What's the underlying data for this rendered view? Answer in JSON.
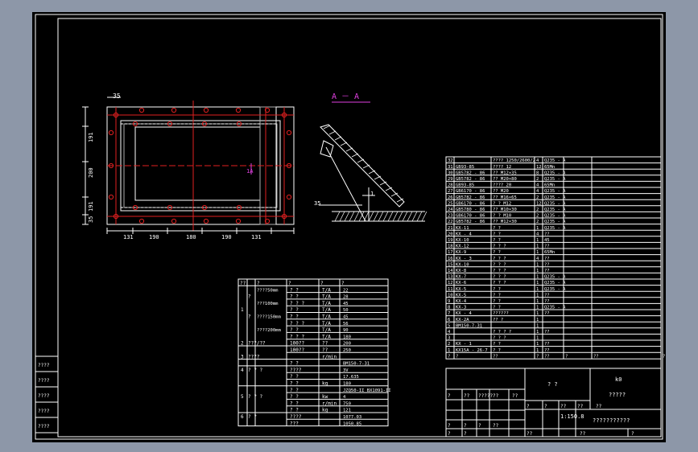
{
  "window_bg": "#8d97a8",
  "colors": {
    "line": "#ffffff",
    "red": "#e02020",
    "magenta": "#e040e0",
    "grey": "#b0b0b0"
  },
  "drawing": {
    "dims_top": "35",
    "dims_left": [
      "191",
      "200",
      "191",
      "35"
    ],
    "dims_bottom": [
      "131",
      "190",
      "180",
      "190",
      "131"
    ],
    "section_tag": "1A",
    "section_title": "A － A",
    "weld_label": "35",
    "weld_dim": "1"
  },
  "param_table": {
    "col_header": [
      "??",
      "",
      "?",
      "?",
      "?",
      "?"
    ],
    "rows": [
      {
        "no": "",
        "a": "",
        "b": "????50mm",
        "c": "? ?",
        "d": "T/A",
        "e": "22"
      },
      {
        "no": "",
        "a": "?",
        "b": "",
        "c": "? ?",
        "d": "T/A",
        "e": "28"
      },
      {
        "no": "",
        "a": "",
        "b": "???100mm",
        "c": "? ? ?",
        "d": "T/A",
        "e": "45"
      },
      {
        "no": "1",
        "a": "",
        "b": "",
        "c": "? ?",
        "d": "T/A",
        "e": "50"
      },
      {
        "no": "",
        "a": "?",
        "b": "????150mm",
        "c": "? ?",
        "d": "T/A",
        "e": "45"
      },
      {
        "no": "",
        "a": "",
        "b": "",
        "c": "? ? ?",
        "d": "T/A",
        "e": "56"
      },
      {
        "no": "",
        "a": "",
        "b": "????200mm",
        "c": "? ?",
        "d": "T/A",
        "e": "90"
      },
      {
        "no": "",
        "a": "",
        "b": "",
        "c": "? ? ?",
        "d": "T/A",
        "e": "180"
      },
      {
        "no": "2",
        "a": "???/??",
        "b": "",
        "c": "100??",
        "d": "??",
        "e": "200"
      },
      {
        "no": "",
        "a": "",
        "b": "",
        "c": "100??",
        "d": "??",
        "e": "250"
      },
      {
        "no": "3",
        "a": "????",
        "b": "",
        "c": "",
        "d": "r/min",
        "e": ""
      },
      {
        "no": "",
        "a": "",
        "b": "",
        "c": "? ?",
        "d": "",
        "e": "BM150-7-31"
      },
      {
        "no": "4",
        "a": "? ? ?",
        "b": "",
        "c": "????",
        "d": "",
        "e": "3V"
      },
      {
        "no": "",
        "a": "",
        "b": "",
        "c": "? ?",
        "d": "",
        "e": "17.635"
      },
      {
        "no": "",
        "a": "",
        "b": "",
        "c": "? ?",
        "d": "kg",
        "e": "180"
      },
      {
        "no": "",
        "a": "",
        "b": "",
        "c": "? ?",
        "d": "",
        "e": "JZQ50-II BX1091-II"
      },
      {
        "no": "5",
        "a": "? ? ?",
        "b": "",
        "c": "? ?",
        "d": "kw",
        "e": "4"
      },
      {
        "no": "",
        "a": "",
        "b": "",
        "c": "? ?",
        "d": "r/min",
        "e": "750"
      },
      {
        "no": "",
        "a": "",
        "b": "",
        "c": "? ?",
        "d": "kg",
        "e": "121"
      },
      {
        "no": "6",
        "a": "? ?",
        "b": "",
        "c": "????",
        "d": "",
        "e": "1077.03"
      },
      {
        "no": "",
        "a": "",
        "b": "",
        "c": "???",
        "d": "",
        "e": "1050.85"
      }
    ]
  },
  "bom": {
    "rows": [
      {
        "no": "32",
        "code": "",
        "name": "???? 1250/2600/2",
        "qty": "4",
        "mat": "Q235 - A"
      },
      {
        "no": "31",
        "code": "GB93-85",
        "name": "???? 12",
        "qty": "12",
        "mat": "65Mn"
      },
      {
        "no": "30",
        "code": "GB5782 - 86",
        "name": "?? M12×35",
        "qty": "8",
        "mat": "Q235 - A"
      },
      {
        "no": "29",
        "code": "GB5782 - 86",
        "name": "?? M20×80",
        "qty": "2",
        "mat": "Q235 - A"
      },
      {
        "no": "28",
        "code": "GB93-85",
        "name": "???? 20",
        "qty": "4",
        "mat": "65Mn"
      },
      {
        "no": "27",
        "code": "GB6170 - 86",
        "name": "?? M20",
        "qty": "4",
        "mat": "Q235 - A"
      },
      {
        "no": "26",
        "code": "GB5782 - 86",
        "name": "?? M16×65",
        "qty": "2",
        "mat": "Q235 - A"
      },
      {
        "no": "25",
        "code": "GB6170 - 86",
        "name": "? ? M12",
        "qty": "12",
        "mat": "Q235 - A"
      },
      {
        "no": "24",
        "code": "GB5780 - 86",
        "name": "?? M10×30",
        "qty": "2",
        "mat": "Q235 - A"
      },
      {
        "no": "23",
        "code": "GB6170 - 86",
        "name": "? ? M10",
        "qty": "2",
        "mat": "Q235 - A"
      },
      {
        "no": "22",
        "code": "GB5782 - 86",
        "name": "?? M12×30",
        "qty": "2",
        "mat": "Q235 - A"
      },
      {
        "no": "21",
        "code": "KX-11",
        "name": "? ?",
        "qty": "1",
        "mat": "Q235 - A"
      },
      {
        "no": "20",
        "code": "KX - 4",
        "name": "? ?",
        "qty": "4",
        "mat": "??"
      },
      {
        "no": "19",
        "code": "KX-10",
        "name": "? ?",
        "qty": "1",
        "mat": "45"
      },
      {
        "no": "18",
        "code": "KX-12",
        "name": "? ? ?",
        "qty": "1",
        "mat": "??"
      },
      {
        "no": "17",
        "code": "KX-9",
        "name": "? ?",
        "qty": "1",
        "mat": "65Mn"
      },
      {
        "no": "16",
        "code": "KX - 3",
        "name": "? ? ?",
        "qty": "4",
        "mat": "??"
      },
      {
        "no": "15",
        "code": "KX-10",
        "name": "? ? ?",
        "qty": "1",
        "mat": "??"
      },
      {
        "no": "14",
        "code": "KX-8",
        "name": "? ? ?",
        "qty": "1",
        "mat": "??"
      },
      {
        "no": "13",
        "code": "KX-7",
        "name": "? ? ?",
        "qty": "1",
        "mat": "Q235 - A"
      },
      {
        "no": "12",
        "code": "KX-6",
        "name": "? ? ?",
        "qty": "1",
        "mat": "Q235 - A"
      },
      {
        "no": "11",
        "code": "KX-5",
        "name": "? ?",
        "qty": "1",
        "mat": "Q235 - A"
      },
      {
        "no": "10",
        "code": "KX-5",
        "name": "? ?",
        "qty": "1",
        "mat": "??"
      },
      {
        "no": "9",
        "code": "KX-4",
        "name": "? ?",
        "qty": "1",
        "mat": "??"
      },
      {
        "no": "8",
        "code": "KX-3",
        "name": "? ?",
        "qty": "1",
        "mat": "Q235 - A"
      },
      {
        "no": "7",
        "code": "KX - 4",
        "name": "??????",
        "qty": "1",
        "mat": "??"
      },
      {
        "no": "6",
        "code": "KX-2A",
        "name": "?? ?",
        "qty": "1",
        "mat": ""
      },
      {
        "no": "5",
        "code": "BM150-7-31",
        "name": "",
        "qty": "1",
        "mat": ""
      },
      {
        "no": "4",
        "code": "",
        "name": "? ? ? ?",
        "qty": "1",
        "mat": "??"
      },
      {
        "no": "3",
        "code": "",
        "name": "? ? ?",
        "qty": "1",
        "mat": ""
      },
      {
        "no": "2",
        "code": "KX - 1",
        "name": "? ?",
        "qty": "1",
        "mat": "??"
      },
      {
        "no": "1",
        "code": "KX15A - 26-7",
        "name": "? ?",
        "qty": "1",
        "mat": "??"
      }
    ],
    "header": [
      "?",
      "?",
      "??",
      "?",
      "??",
      "?",
      "??",
      "?"
    ]
  },
  "title_block": {
    "center_top": "? ?",
    "right_code": "k0",
    "right_sub": "?????",
    "sign_cells": [
      "?",
      "??",
      "?????",
      "??",
      "??"
    ],
    "row2": [
      "?",
      "?",
      "??",
      "??",
      "??"
    ],
    "row3": [
      "?",
      "?",
      "?",
      "??"
    ],
    "scale": "1:150.8",
    "company": "???????????",
    "bottom_cells": [
      "?",
      "?",
      "??",
      "??",
      "?"
    ]
  },
  "left_tags": [
    "????",
    "????",
    "????",
    "????",
    "????"
  ]
}
